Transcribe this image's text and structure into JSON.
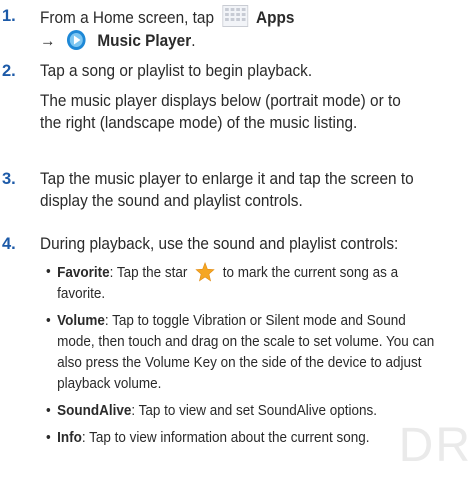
{
  "steps": [
    {
      "number": "1.",
      "part1": "From a Home screen, tap",
      "apps_label": "Apps",
      "arrow": "→",
      "music_label": "Music Player",
      "period": "."
    },
    {
      "number": "2.",
      "line1": "Tap a song or playlist to begin playback.",
      "line2": "The music player displays below (portrait mode) or to",
      "line3": "the right (landscape mode) of the music listing."
    },
    {
      "number": "3.",
      "line1": "Tap the music player to enlarge it and tap the screen to",
      "line2": "display the sound and playlist controls."
    },
    {
      "number": "4.",
      "line1": "During playback, use the sound and playlist controls:"
    }
  ],
  "bullets": [
    {
      "term": "Favorite",
      "pre_icon": ": Tap the star",
      "post_icon": "to mark the current song as a",
      "cont": "favorite."
    },
    {
      "term": "Volume",
      "l1": ": Tap to toggle Vibration or Silent mode and Sound",
      "l2": "mode, then touch and drag on the scale to set volume. You can",
      "l3": "also press the Volume Key on the side of the device to adjust",
      "l4": "playback volume."
    },
    {
      "term": "SoundAlive",
      "l1": ": Tap to view and set SoundAlive options."
    },
    {
      "term": "Info",
      "l1": ": Tap to view information about the current song."
    }
  ],
  "bullet_char": "•",
  "watermark": "DR",
  "icons": {
    "apps": "apps-grid-icon",
    "music": "music-player-icon",
    "star": "star-icon"
  },
  "colors": {
    "number": "#1c5aa8",
    "star": "#f5a623",
    "music_icon": "#1e88d6"
  }
}
